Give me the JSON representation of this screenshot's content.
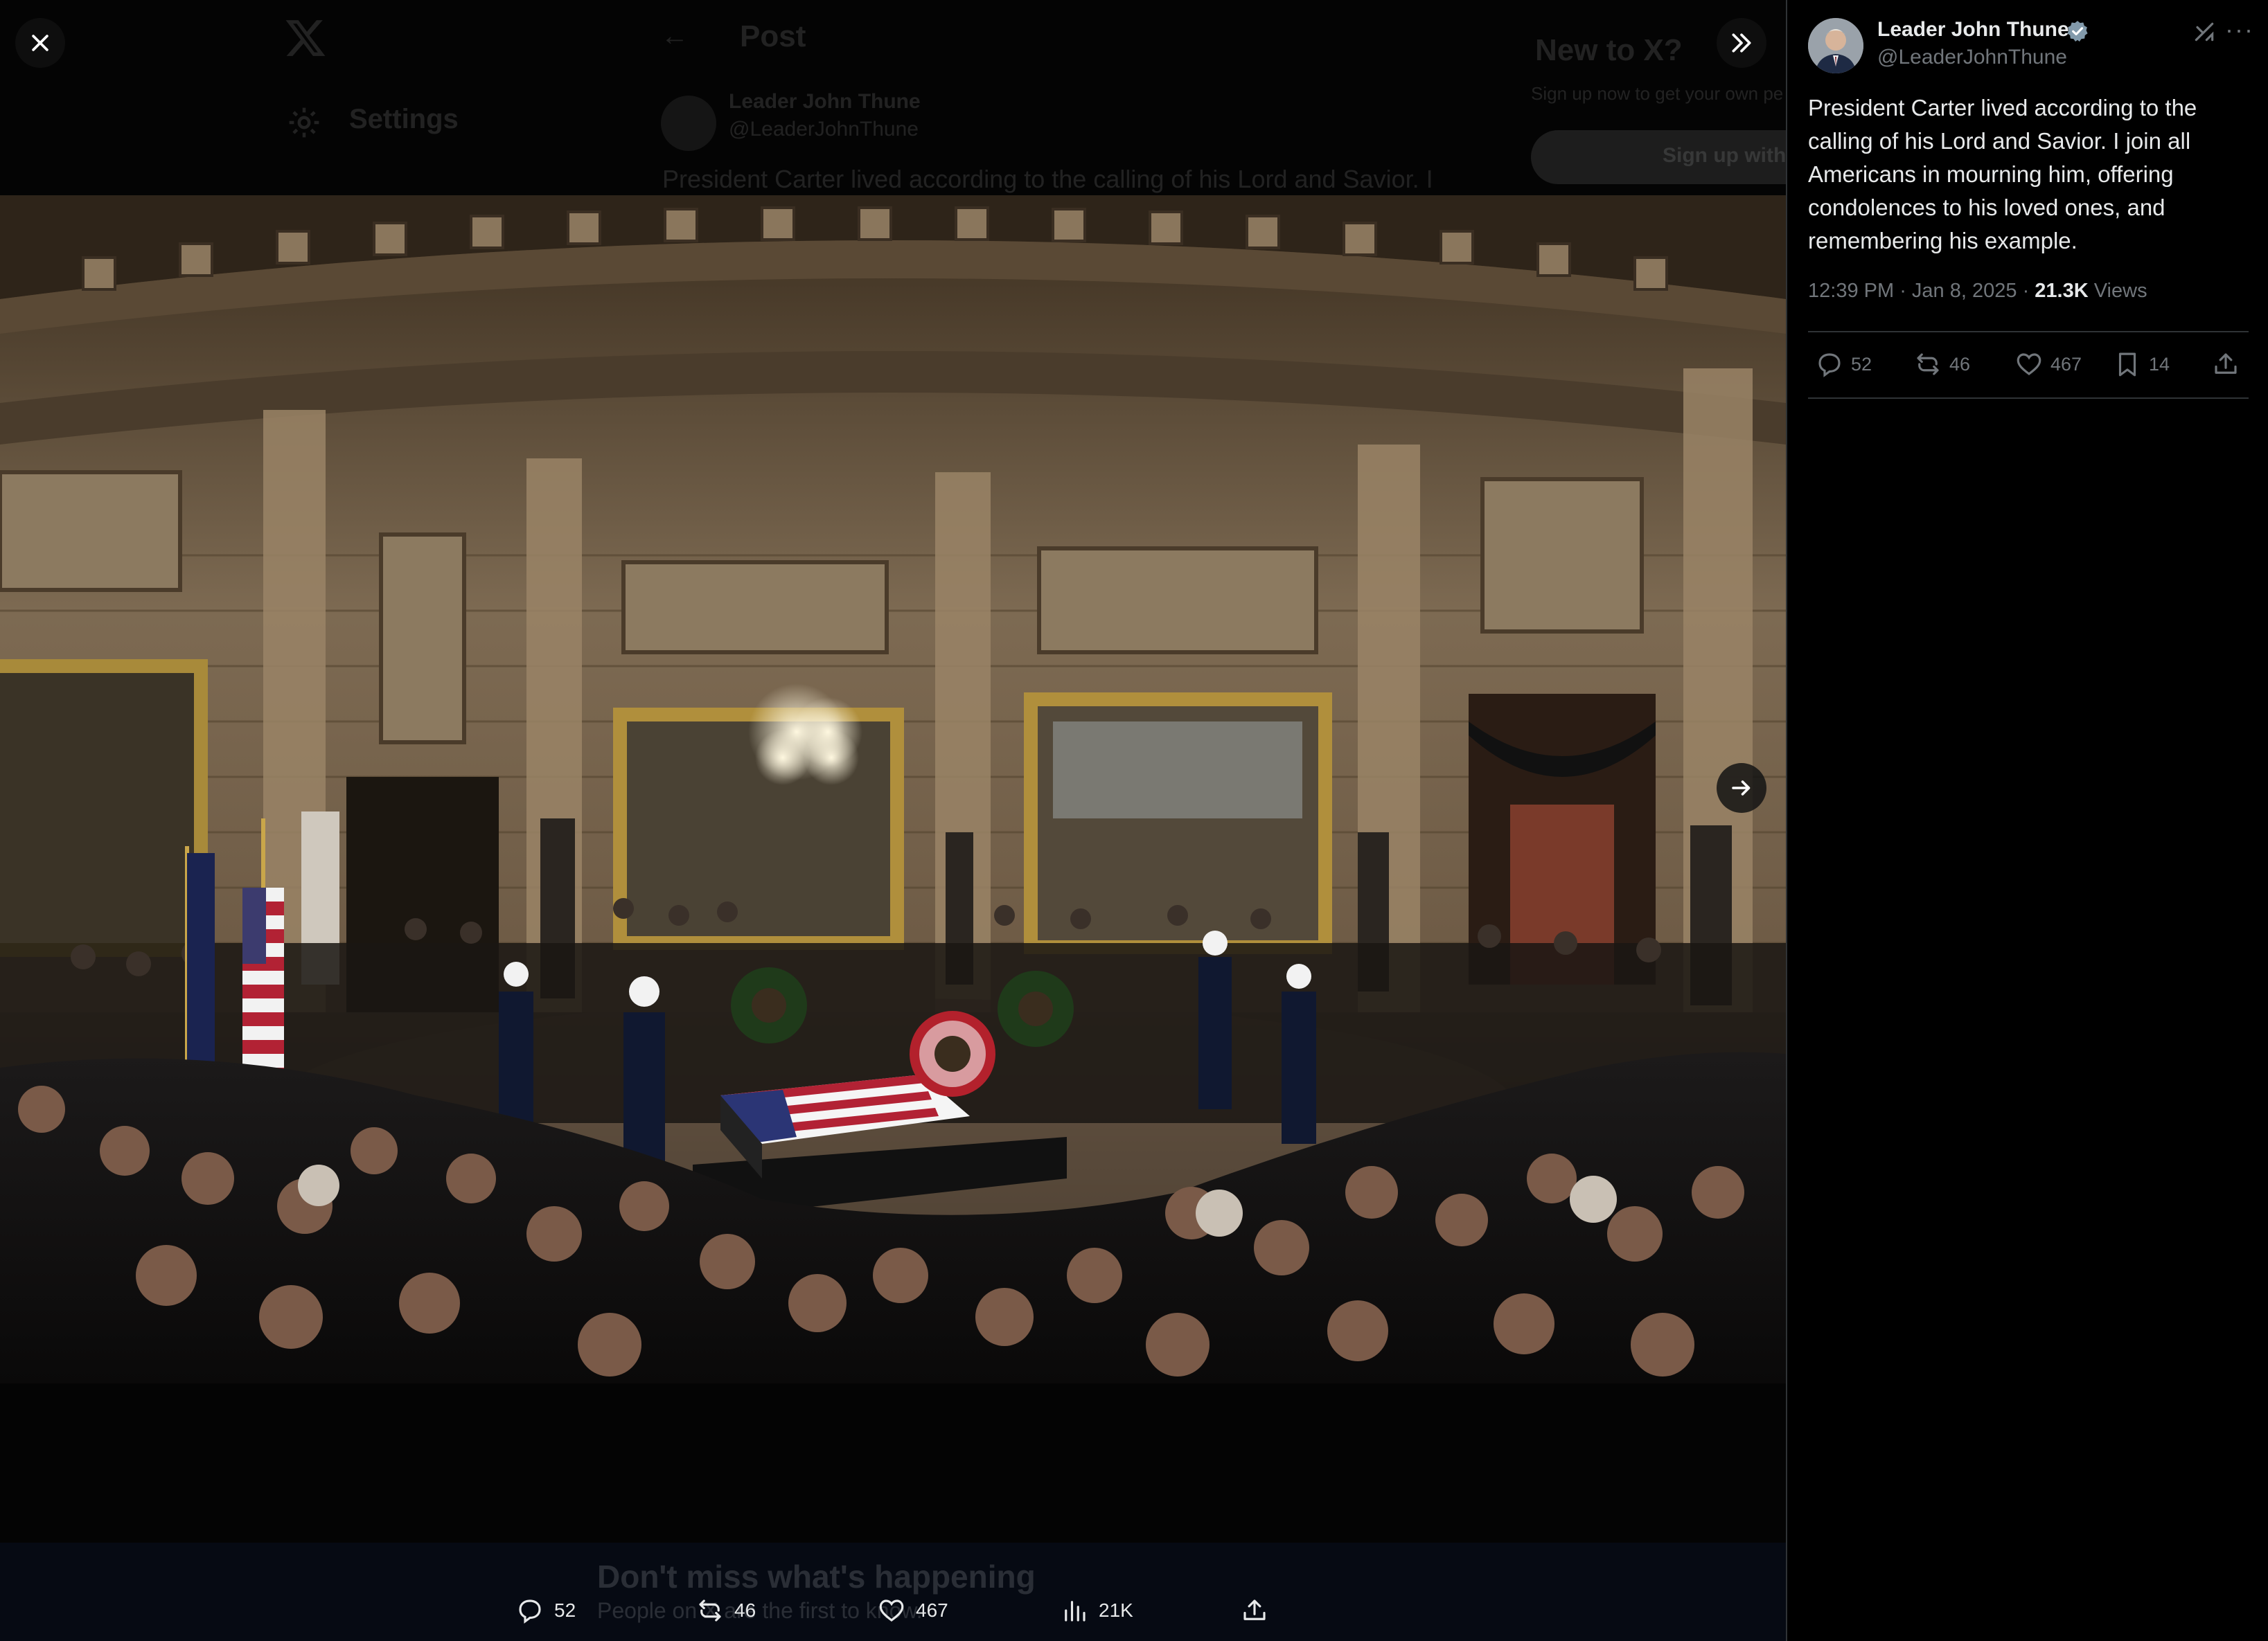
{
  "background_page": {
    "back_glyph": "←",
    "header_title": "Post",
    "nav_settings": "Settings",
    "post_author": "Leader John Thune",
    "post_handle": "@LeaderJohnThune",
    "post_excerpt": "President Carter lived according to the calling of his Lord and Savior. I",
    "new_to_x": "New to X?",
    "signup_note": "Sign up now to get your own pe",
    "signup_button": "Sign up with",
    "dont_miss": "Don't miss what's happening",
    "people_on_x": "People on X are the first to know."
  },
  "viewer": {
    "close_icon": "close-icon",
    "expand_icon": "double-chevron-right-icon",
    "next_icon": "arrow-right-icon",
    "actions": {
      "replies": "52",
      "reposts": "46",
      "likes": "467",
      "views": "21K"
    }
  },
  "post": {
    "author_name": "Leader John Thune",
    "handle": "@LeaderJohnThune",
    "text": "President Carter lived according to the calling of his Lord and Savior. I join all Americans in mourning him, offering condolences to his loved ones, and remembering his example.",
    "time": "12:39 PM",
    "date": "Jan 8, 2025",
    "views_count": "21.3K",
    "views_label": "Views",
    "actions": {
      "replies": "52",
      "reposts": "46",
      "likes": "467",
      "bookmarks": "14"
    }
  },
  "colors": {
    "background": "#000000",
    "text_primary": "#e7e9ea",
    "text_secondary": "#71767b",
    "divider": "#2f3336",
    "verified": "#829aab"
  }
}
